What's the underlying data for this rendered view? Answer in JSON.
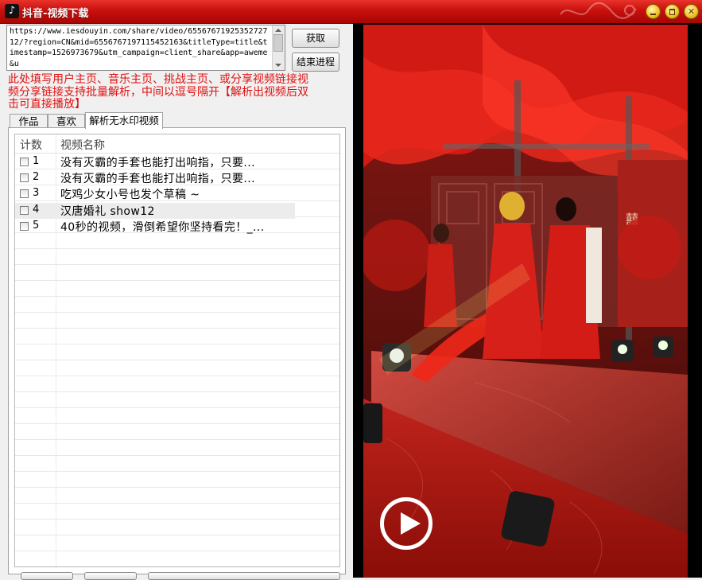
{
  "window": {
    "title": "抖音-视频下载",
    "app_icon": "♪",
    "buttons": [
      "minimize-icon",
      "maximize-icon",
      "close-icon"
    ]
  },
  "url_input": {
    "value": "https://www.iesdouyin.com/share/video/6556767192535272712/?region=CN&mid=6556767197115452163&titleType=title&timestamp=1526973679&utm_campaign=client_share&app=aweme&u"
  },
  "buttons": {
    "fetch": "获取",
    "stop": "结束进程"
  },
  "hint": "此处填写用户主页、音乐主页、挑战主页、或分享视频链接视频分享链接支持批量解析，中间以逗号隔开【解析出视频后双击可直接播放】",
  "tabs": [
    {
      "label": "作品"
    },
    {
      "label": "喜欢"
    },
    {
      "label": "解析无水印视频",
      "active": true
    }
  ],
  "list": {
    "columns": {
      "count": "计数",
      "name": "视频名称"
    },
    "rows": [
      {
        "num": "1",
        "name": "没有灭霸的手套也能打出响指，只要...",
        "checked": false
      },
      {
        "num": "2",
        "name": "没有灭霸的手套也能打出响指，只要...",
        "checked": false
      },
      {
        "num": "3",
        "name": "吃鸡少女小号也发个草稿 ~",
        "checked": false
      },
      {
        "num": "4",
        "name": "汉唐婚礼 show12",
        "checked": false,
        "selected": true
      },
      {
        "num": "5",
        "name": "40秒的视频，滑倒希望你坚持看完！_...",
        "checked": false
      }
    ]
  },
  "video": {
    "play_icon": "play-icon"
  },
  "colors": {
    "title_bar": "#c8100e",
    "hint_text": "#e01010",
    "video_stage": "#b01010"
  }
}
